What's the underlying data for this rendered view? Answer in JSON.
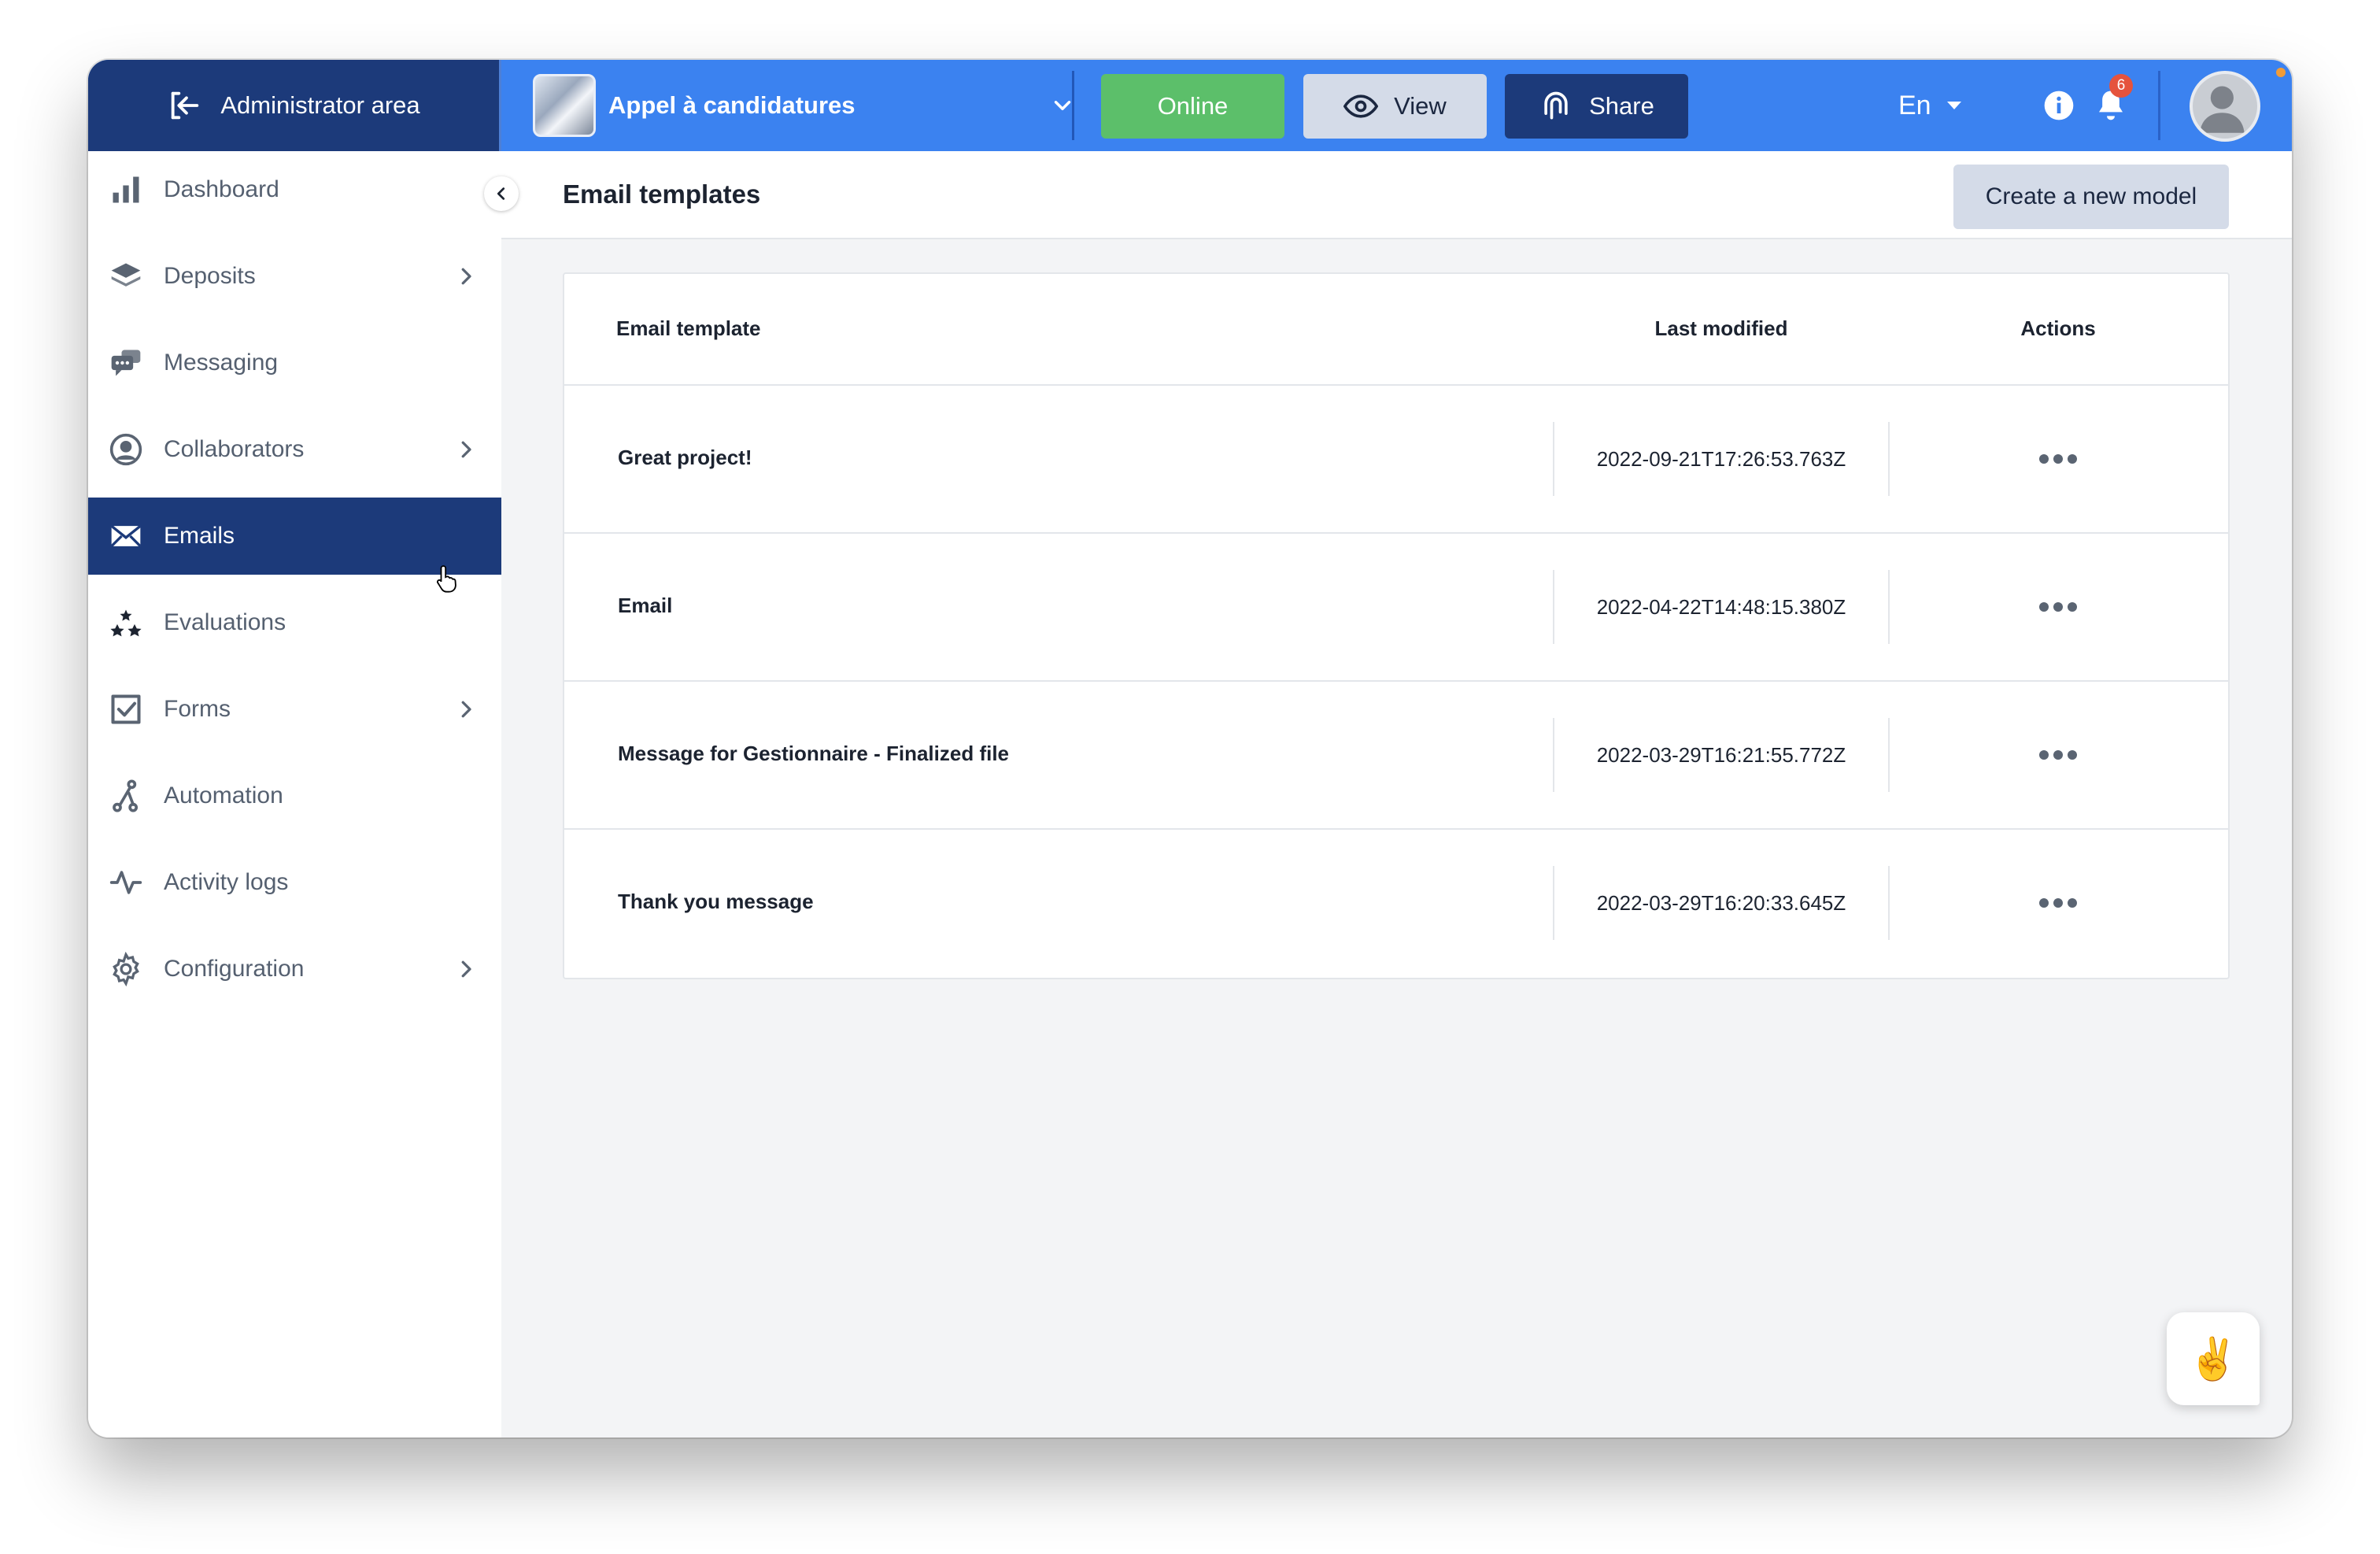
{
  "topbar": {
    "admin_area_label": "Administrator area",
    "campaign_name": "Appel à candidatures",
    "online_label": "Online",
    "view_label": "View",
    "share_label": "Share",
    "language": "En",
    "notification_count": "6"
  },
  "sidebar": {
    "items": [
      {
        "label": "Dashboard",
        "icon": "bar-chart-icon",
        "has_submenu": false,
        "active": false
      },
      {
        "label": "Deposits",
        "icon": "layers-icon",
        "has_submenu": true,
        "active": false
      },
      {
        "label": "Messaging",
        "icon": "chat-bubbles-icon",
        "has_submenu": false,
        "active": false
      },
      {
        "label": "Collaborators",
        "icon": "user-circle-icon",
        "has_submenu": true,
        "active": false
      },
      {
        "label": "Emails",
        "icon": "envelope-icon",
        "has_submenu": false,
        "active": true
      },
      {
        "label": "Evaluations",
        "icon": "stars-icon",
        "has_submenu": false,
        "active": false
      },
      {
        "label": "Forms",
        "icon": "checkbox-icon",
        "has_submenu": true,
        "active": false
      },
      {
        "label": "Automation",
        "icon": "flow-icon",
        "has_submenu": false,
        "active": false
      },
      {
        "label": "Activity logs",
        "icon": "pulse-icon",
        "has_submenu": false,
        "active": false
      },
      {
        "label": "Configuration",
        "icon": "gear-icon",
        "has_submenu": true,
        "active": false
      }
    ]
  },
  "main": {
    "title": "Email templates",
    "create_button_label": "Create a new model",
    "table": {
      "columns": [
        "Email template",
        "Last modified",
        "Actions"
      ],
      "rows": [
        {
          "name": "Great project!",
          "last_modified": "2022-09-21T17:26:53.763Z"
        },
        {
          "name": "Email",
          "last_modified": "2022-04-22T14:48:15.380Z"
        },
        {
          "name": "Message for Gestionnaire - Finalized file",
          "last_modified": "2022-03-29T16:21:55.772Z"
        },
        {
          "name": "Thank you message",
          "last_modified": "2022-03-29T16:20:33.645Z"
        }
      ]
    }
  },
  "chat_widget": {
    "emoji": "✌️"
  },
  "colors": {
    "topbar": "#3b82f0",
    "navy": "#1c3a7a",
    "online_green": "#5cbf6a",
    "badge_red": "#e5533d"
  }
}
